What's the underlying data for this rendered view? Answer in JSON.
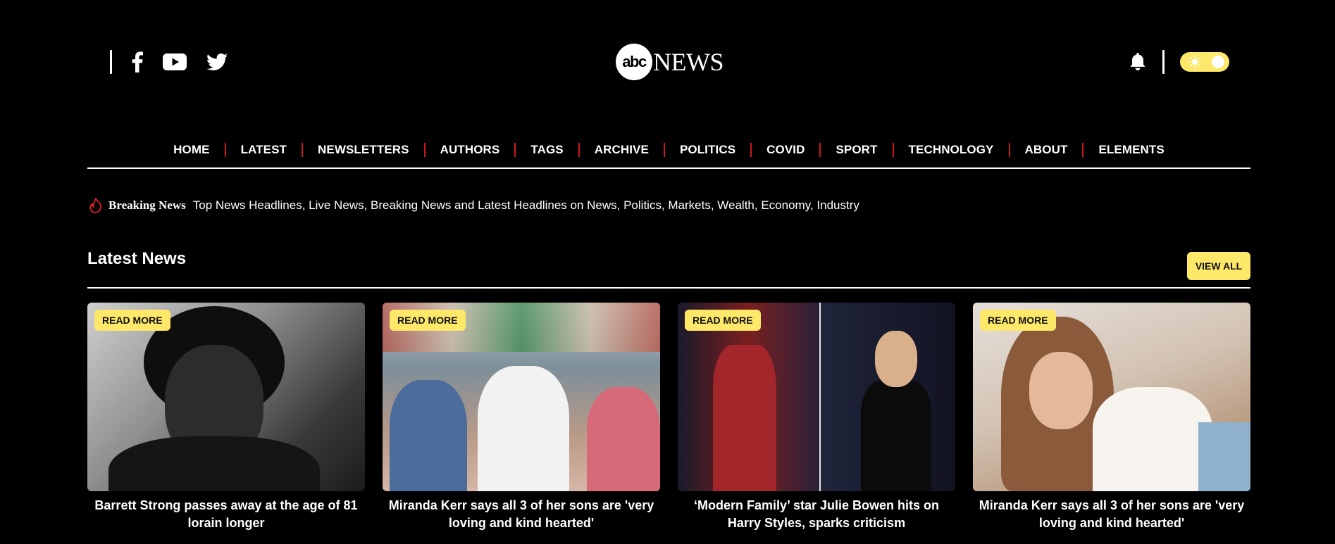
{
  "header": {
    "logo_mark": "abc",
    "logo_text": "NEWS",
    "social": [
      "facebook-icon",
      "youtube-icon",
      "twitter-icon"
    ]
  },
  "nav": {
    "items": [
      "HOME",
      "LATEST",
      "NEWSLETTERS",
      "AUTHORS",
      "TAGS",
      "ARCHIVE",
      "POLITICS",
      "COVID",
      "SPORT",
      "TECHNOLOGY",
      "ABOUT",
      "ELEMENTS"
    ]
  },
  "breaking": {
    "tag": "Breaking News",
    "headline": "Top News Headlines, Live News, Breaking News and Latest Headlines on News, Politics, Markets, Wealth, Economy, Industry"
  },
  "latest": {
    "title": "Latest News",
    "view_all": "VIEW ALL",
    "read_more": "READ MORE",
    "cards": [
      {
        "title": "Barrett Strong passes away at the age of 81 lorain longer"
      },
      {
        "title": "Miranda Kerr says all 3 of her sons are 'very loving and kind hearted'"
      },
      {
        "title": "‘Modern Family’ star Julie Bowen hits on Harry Styles, sparks criticism"
      },
      {
        "title": "Miranda Kerr says all 3 of her sons are 'very loving and kind hearted'"
      }
    ]
  },
  "colors": {
    "accent": "#fde86a",
    "separator": "#d0161f",
    "background": "#000000"
  }
}
